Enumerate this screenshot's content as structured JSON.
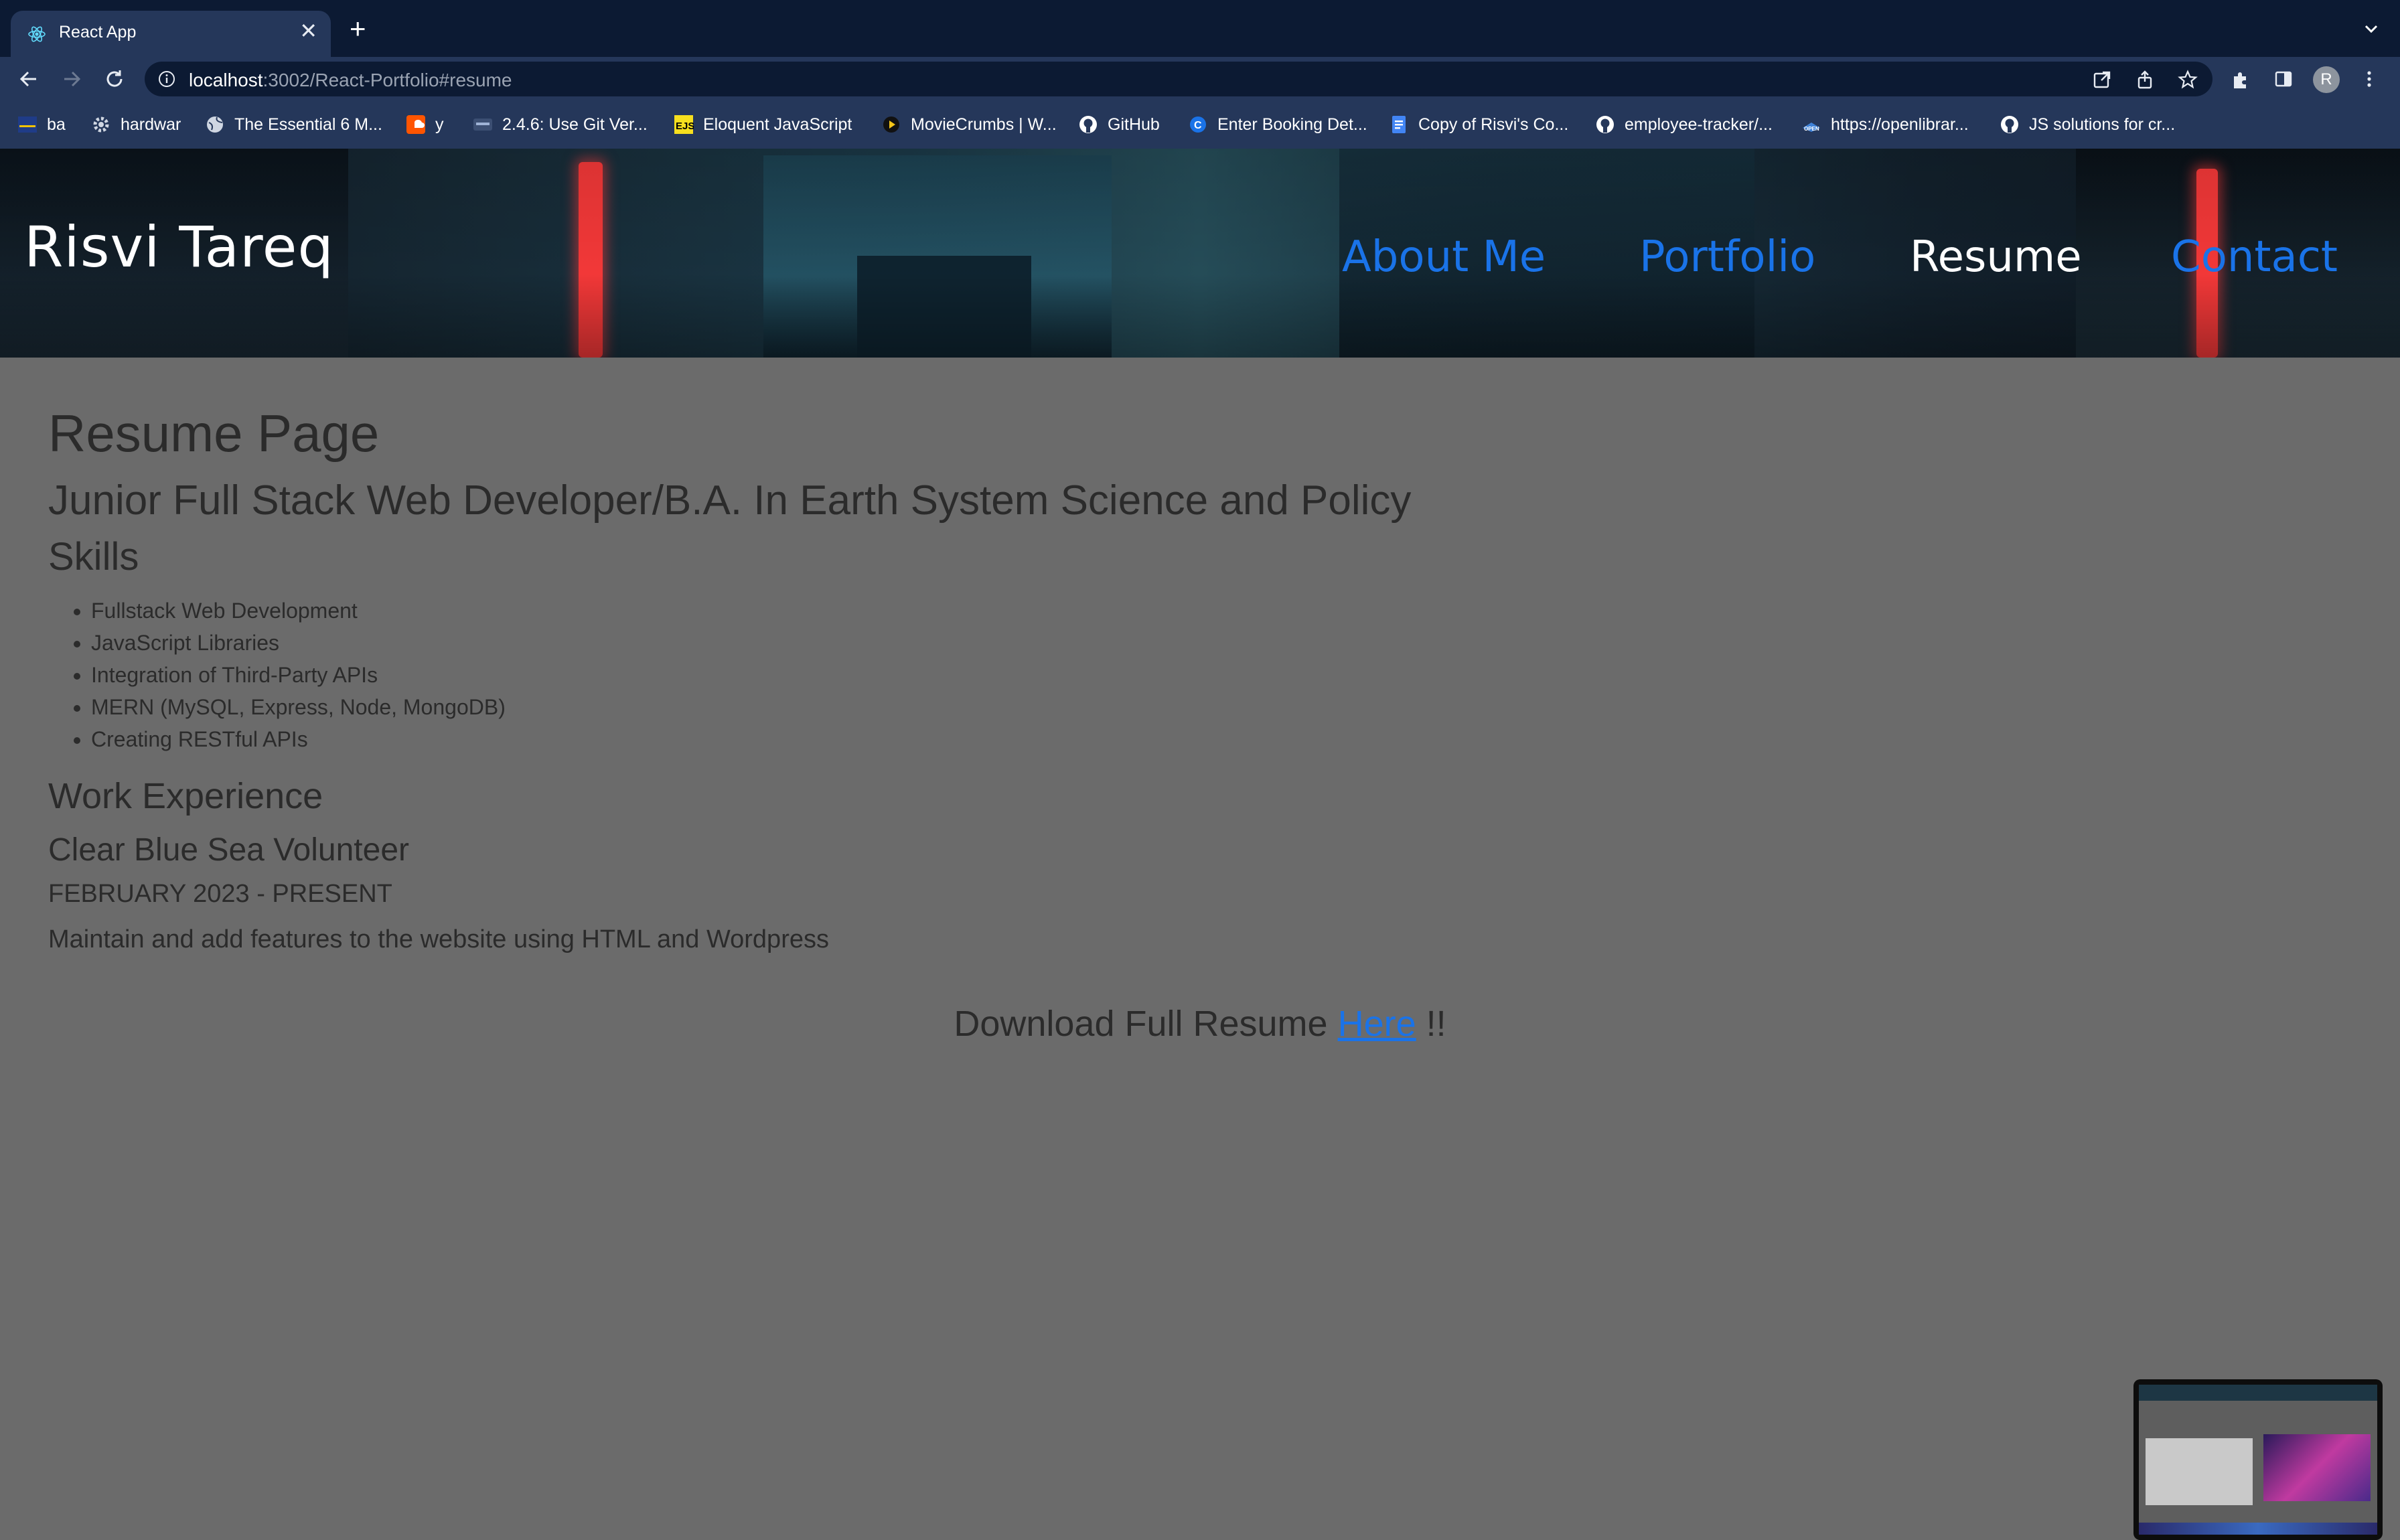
{
  "browser": {
    "tab_title": "React App",
    "url_host": "localhost",
    "url_rest": ":3002/React-Portfolio#resume",
    "profile_initial": "R"
  },
  "bookmarks": [
    {
      "label": "ba",
      "icon": "uci-icon"
    },
    {
      "label": "hardwar",
      "icon": "gear-icon"
    },
    {
      "label": "The Essential 6 M...",
      "icon": "globe-icon"
    },
    {
      "label": "y",
      "icon": "soundcloud-icon"
    },
    {
      "label": "2.4.6: Use Git Ver...",
      "icon": "site-icon"
    },
    {
      "label": "Eloquent JavaScript",
      "icon": "ejs-icon"
    },
    {
      "label": "MovieCrumbs | W...",
      "icon": "moviecrumbs-icon"
    },
    {
      "label": "GitHub",
      "icon": "github-icon"
    },
    {
      "label": "Enter Booking Det...",
      "icon": "booking-icon"
    },
    {
      "label": "Copy of Risvi's Co...",
      "icon": "docs-icon"
    },
    {
      "label": "employee-tracker/...",
      "icon": "github-icon"
    },
    {
      "label": "https://openlibrar...",
      "icon": "openlibrary-icon"
    },
    {
      "label": "JS solutions for cr...",
      "icon": "github-icon"
    }
  ],
  "header": {
    "brand": "Risvi Tareq",
    "nav": [
      {
        "label": "About Me",
        "active": false
      },
      {
        "label": "Portfolio",
        "active": false
      },
      {
        "label": "Resume",
        "active": true
      },
      {
        "label": "Contact",
        "active": false
      }
    ]
  },
  "resume": {
    "page_title": "Resume Page",
    "subtitle": "Junior Full Stack Web Developer/B.A. In Earth System Science and Policy",
    "skills_heading": "Skills",
    "skills": [
      "Fullstack Web Development",
      "JavaScript Libraries",
      "Integration of Third-Party APIs",
      "MERN (MySQL, Express, Node, MongoDB)",
      "Creating RESTful APIs"
    ],
    "work_heading": "Work Experience",
    "job_title": "Clear Blue Sea Volunteer",
    "job_dates": "FEBRUARY 2023 - PRESENT",
    "job_description": "Maintain and add features to the website using HTML and Wordpress",
    "download_prefix": "Download Full Resume",
    "download_link": "Here",
    "download_suffix": "!!"
  },
  "colors": {
    "page_background": "#6b6b6b",
    "nav_link": "#1a73e8",
    "nav_active": "#ffffff",
    "chrome_dark": "#0c1a33",
    "chrome_toolbar": "#25375a"
  }
}
